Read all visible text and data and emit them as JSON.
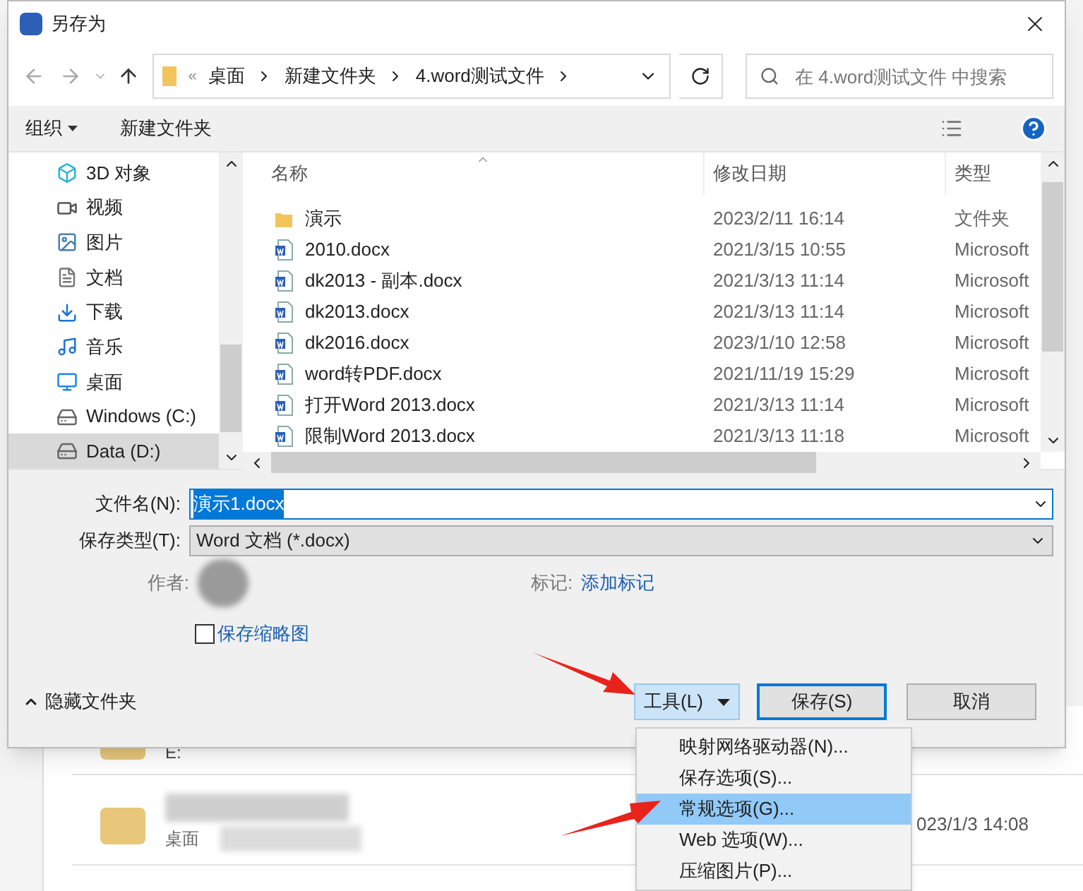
{
  "window": {
    "title": "另存为"
  },
  "address": {
    "separator": "«",
    "crumbs": [
      "桌面",
      "新建文件夹",
      "4.word测试文件"
    ]
  },
  "search": {
    "placeholder": "在 4.word测试文件 中搜索"
  },
  "toolbar": {
    "organize": "组织",
    "new_folder": "新建文件夹"
  },
  "sidebar": {
    "items": [
      {
        "label": "3D 对象",
        "kind": "cube",
        "selected": false
      },
      {
        "label": "视频",
        "kind": "video",
        "selected": false
      },
      {
        "label": "图片",
        "kind": "image",
        "selected": false
      },
      {
        "label": "文档",
        "kind": "doc",
        "selected": false
      },
      {
        "label": "下载",
        "kind": "download",
        "selected": false
      },
      {
        "label": "音乐",
        "kind": "music",
        "selected": false
      },
      {
        "label": "桌面",
        "kind": "desktop",
        "selected": false
      },
      {
        "label": "Windows (C:)",
        "kind": "drive",
        "selected": false
      },
      {
        "label": "Data (D:)",
        "kind": "drive",
        "selected": true
      }
    ]
  },
  "table": {
    "columns": [
      "名称",
      "修改日期",
      "类型"
    ],
    "rows": [
      {
        "name": "演示",
        "date": "2023/2/11 16:14",
        "type": "文件夹",
        "kind": "folder"
      },
      {
        "name": "2010.docx",
        "date": "2021/3/15 10:55",
        "type": "Microsoft",
        "kind": "word"
      },
      {
        "name": "dk2013 - 副本.docx",
        "date": "2021/3/13 11:14",
        "type": "Microsoft",
        "kind": "word"
      },
      {
        "name": "dk2013.docx",
        "date": "2021/3/13 11:14",
        "type": "Microsoft",
        "kind": "word"
      },
      {
        "name": "dk2016.docx",
        "date": "2023/1/10 12:58",
        "type": "Microsoft",
        "kind": "word"
      },
      {
        "name": "word转PDF.docx",
        "date": "2021/11/19 15:29",
        "type": "Microsoft",
        "kind": "word"
      },
      {
        "name": "打开Word 2013.docx",
        "date": "2021/3/13 11:14",
        "type": "Microsoft",
        "kind": "word"
      },
      {
        "name": "限制Word 2013.docx",
        "date": "2021/3/13 11:18",
        "type": "Microsoft",
        "kind": "word"
      }
    ]
  },
  "form": {
    "filename_label": "文件名(N):",
    "filename": "演示1.docx",
    "filetype_label": "保存类型(T):",
    "filetype": "Word 文档 (*.docx)",
    "author_label": "作者:",
    "tags_label": "标记:",
    "tags_value": "添加标记",
    "thumbnail": {
      "label": "保存缩略图",
      "checked": false
    }
  },
  "footer": {
    "hide_folders": "隐藏文件夹",
    "tools": "工具(L)",
    "save": "保存(S)",
    "cancel": "取消"
  },
  "tools_menu": [
    {
      "label": "映射网络驱动器(N)...",
      "selected": false
    },
    {
      "label": "保存选项(S)...",
      "selected": false
    },
    {
      "label": "常规选项(G)...",
      "selected": true
    },
    {
      "label": "Web 选项(W)...",
      "selected": false
    },
    {
      "label": "压缩图片(P)...",
      "selected": false
    }
  ],
  "background": {
    "drive_label": "E:",
    "location": "桌面",
    "date": "023/1/3 14:08"
  }
}
